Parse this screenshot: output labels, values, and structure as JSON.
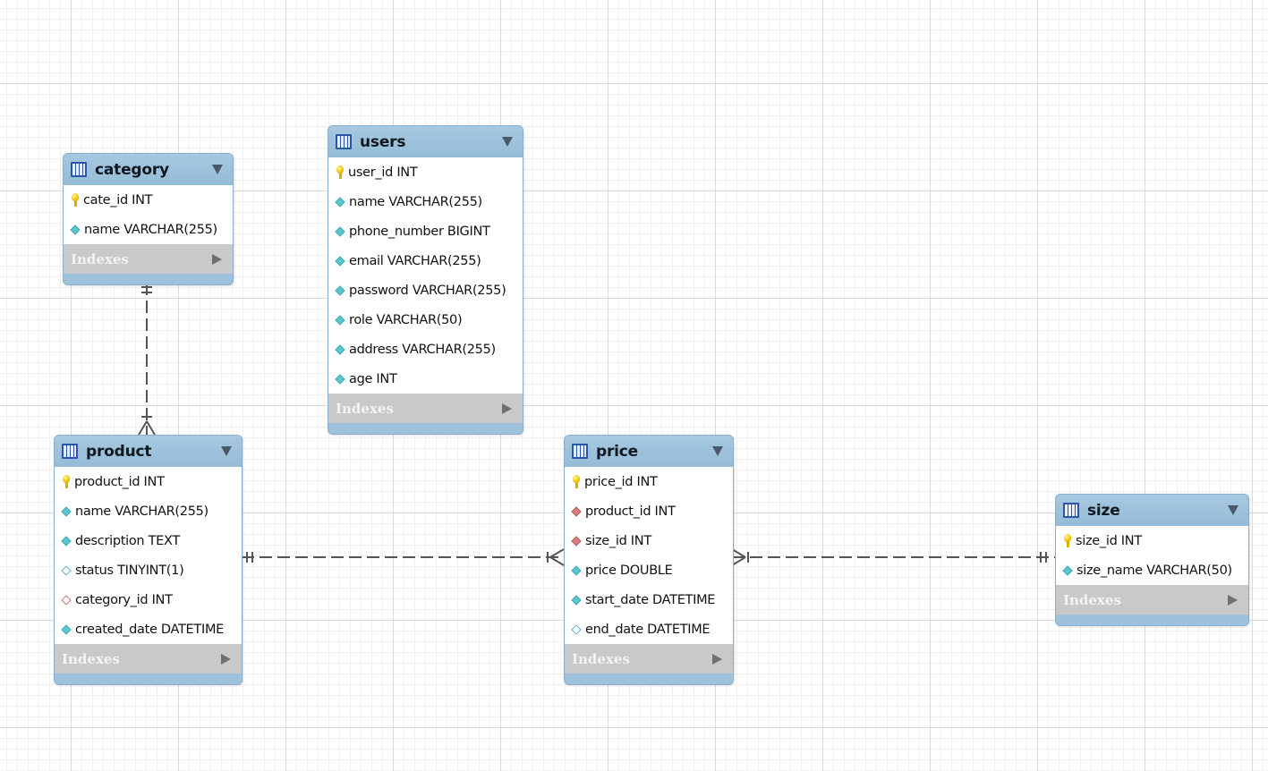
{
  "diagram": {
    "indexes_label": "Indexes",
    "tables": {
      "category": {
        "name": "category",
        "columns": [
          {
            "text": "cate_id INT",
            "icon": "primary-key-icon"
          },
          {
            "text": "name VARCHAR(255)",
            "icon": "column-notnull-icon"
          }
        ]
      },
      "users": {
        "name": "users",
        "columns": [
          {
            "text": "user_id INT",
            "icon": "primary-key-icon"
          },
          {
            "text": "name VARCHAR(255)",
            "icon": "column-notnull-icon"
          },
          {
            "text": "phone_number BIGINT",
            "icon": "column-notnull-icon"
          },
          {
            "text": "email VARCHAR(255)",
            "icon": "column-notnull-icon"
          },
          {
            "text": "password VARCHAR(255)",
            "icon": "column-notnull-icon"
          },
          {
            "text": "role VARCHAR(50)",
            "icon": "column-notnull-icon"
          },
          {
            "text": "address VARCHAR(255)",
            "icon": "column-notnull-icon"
          },
          {
            "text": "age INT",
            "icon": "column-notnull-icon"
          }
        ]
      },
      "product": {
        "name": "product",
        "columns": [
          {
            "text": "product_id INT",
            "icon": "primary-key-icon"
          },
          {
            "text": "name VARCHAR(255)",
            "icon": "column-notnull-icon"
          },
          {
            "text": "description TEXT",
            "icon": "column-notnull-icon"
          },
          {
            "text": "status TINYINT(1)",
            "icon": "column-nullable-icon"
          },
          {
            "text": "category_id INT",
            "icon": "foreign-key-nullable-icon"
          },
          {
            "text": "created_date DATETIME",
            "icon": "column-notnull-icon"
          }
        ]
      },
      "price": {
        "name": "price",
        "columns": [
          {
            "text": "price_id INT",
            "icon": "primary-key-icon"
          },
          {
            "text": "product_id INT",
            "icon": "foreign-key-icon"
          },
          {
            "text": "size_id INT",
            "icon": "foreign-key-icon"
          },
          {
            "text": "price DOUBLE",
            "icon": "column-notnull-icon"
          },
          {
            "text": "start_date DATETIME",
            "icon": "column-notnull-icon"
          },
          {
            "text": "end_date DATETIME",
            "icon": "column-nullable-icon"
          }
        ]
      },
      "size": {
        "name": "size",
        "columns": [
          {
            "text": "size_id INT",
            "icon": "primary-key-icon"
          },
          {
            "text": "size_name VARCHAR(50)",
            "icon": "column-notnull-icon"
          }
        ]
      }
    },
    "relationships": [
      {
        "from": "category",
        "to": "product",
        "from_cardinality": "one",
        "to_cardinality": "many"
      },
      {
        "from": "product",
        "to": "price",
        "from_cardinality": "one",
        "to_cardinality": "many"
      },
      {
        "from": "size",
        "to": "price",
        "from_cardinality": "one",
        "to_cardinality": "many"
      }
    ],
    "colors": {
      "table_header": "#9ec2dc",
      "indexes_bar": "#c9c9c9",
      "connector": "#555555",
      "primary_key": "#f0c000",
      "column_notnull": "#5bc7d1",
      "foreign_key": "#d97e7e"
    }
  }
}
